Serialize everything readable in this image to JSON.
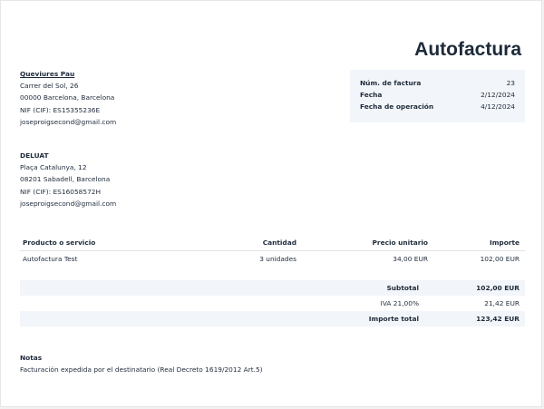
{
  "document": {
    "title": "Autofactura"
  },
  "issuer": {
    "name": "Queviures Pau",
    "address": "Carrer del Sol, 26",
    "city": "00000 Barcelona, Barcelona",
    "tax_id": "NIF (CIF): ES15355236E",
    "email": "joseproigsecond@gmail.com"
  },
  "client": {
    "name": "DELUAT",
    "address": "Plaça Catalunya, 12",
    "city": "08201 Sabadell, Barcelona",
    "tax_id": "NIF (CIF): ES16058572H",
    "email": "joseproigsecond@gmail.com"
  },
  "meta": {
    "invoice_number_label": "Núm. de factura",
    "invoice_number": "23",
    "date_label": "Fecha",
    "date": "2/12/2024",
    "operation_date_label": "Fecha de operación",
    "operation_date": "4/12/2024"
  },
  "items": {
    "headers": [
      "Producto o servicio",
      "Cantidad",
      "Precio unitario",
      "Importe"
    ],
    "rows": [
      [
        "Autofactura Test",
        "3 unidades",
        "34,00 EUR",
        "102,00 EUR"
      ]
    ]
  },
  "totals": {
    "subtotal_label": "Subtotal",
    "subtotal": "102,00 EUR",
    "tax_label": "IVA 21,00%",
    "tax": "21,42 EUR",
    "total_label": "Importe total",
    "total": "123,42 EUR"
  },
  "notes": {
    "heading": "Notas",
    "text": "Facturación expedida por el destinatario (Real Decreto 1619/2012 Art.5)"
  },
  "colors": {
    "text": "#1e2a3a",
    "panel": "#f2f5f9"
  }
}
